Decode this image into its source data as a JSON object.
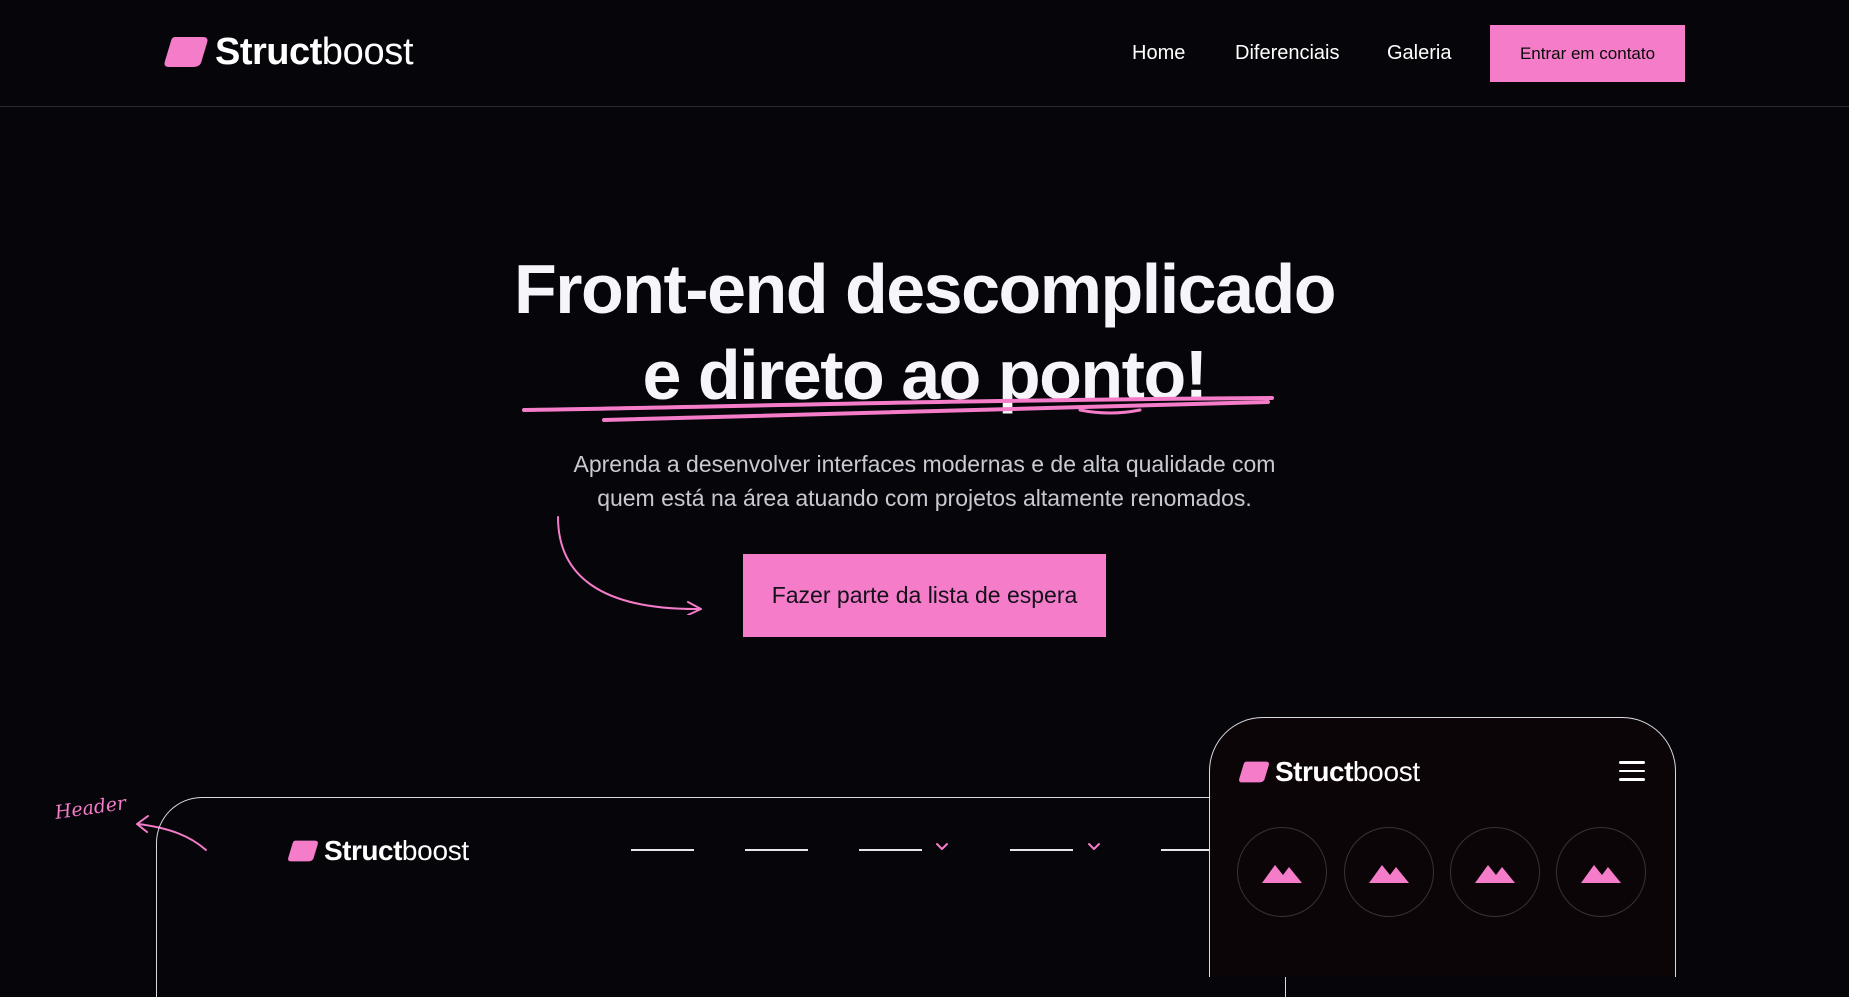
{
  "brand": {
    "name_bold": "Struct",
    "name_light": "boost",
    "accent_color": "#f47cc9",
    "background_color": "#05050a"
  },
  "nav": {
    "home": "Home",
    "diferenciais": "Diferenciais",
    "galeria": "Galeria",
    "contact_button": "Entrar em contato"
  },
  "hero": {
    "title_line1": "Front-end descomplicado",
    "title_line2": "e direto ao ponto!",
    "subtitle_line1": "Aprenda a desenvolver interfaces modernas e de alta qualidade com",
    "subtitle_line2": "quem está na área atuando com projetos altamente renomados.",
    "cta_button": "Fazer parte da lista de espera"
  },
  "showcase": {
    "header_note": "Header",
    "icons": {
      "menu": "hamburger-menu-icon",
      "gallery_item": "mountain-image-icon",
      "dropdown": "chevron-down-icon"
    }
  }
}
